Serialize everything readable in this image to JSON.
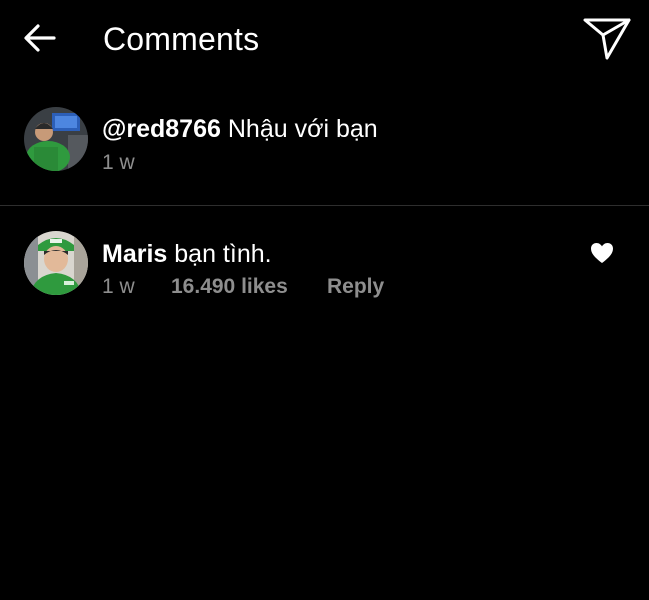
{
  "header": {
    "back_icon": "arrow-left-icon",
    "title": "Comments",
    "share_icon": "paper-plane-icon"
  },
  "caption": {
    "username": "@red8766",
    "text": "Nhậu với bạn",
    "time": "1 w",
    "avatar": "profile photo"
  },
  "comments": [
    {
      "username": "Maris",
      "text": "bạn tình.",
      "time": "1 w",
      "likes": "16.490 likes",
      "reply_label": "Reply",
      "liked": true,
      "like_icon": "heart-filled-icon",
      "avatar": "profile photo"
    }
  ],
  "colors": {
    "background": "#000000",
    "text_primary": "#ffffff",
    "text_secondary": "#8e8e8e",
    "divider": "#2e2e2e",
    "avatar_uniform": "#2f9a3e"
  }
}
